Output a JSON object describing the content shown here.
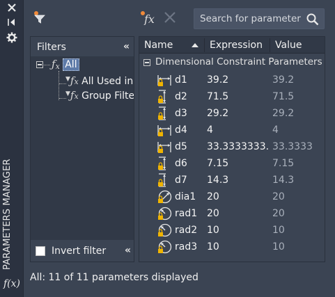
{
  "app": {
    "palette_title": "PARAMETERS MANAGER",
    "palette_fx": "f(x)"
  },
  "toolbar": {
    "search_placeholder": "Search for parameter"
  },
  "filters": {
    "title": "Filters",
    "tree": [
      {
        "label": "All",
        "selected": true
      },
      {
        "label": "All Used in"
      },
      {
        "label": "Group Filte"
      }
    ],
    "invert_label": "Invert filter",
    "invert_checked": false
  },
  "grid": {
    "columns": [
      "Name",
      "Expression",
      "Value"
    ],
    "group_label": "Dimensional Constraint Parameters",
    "rows": [
      {
        "name": "d1",
        "expression": "39.2",
        "value": "39.2",
        "icon": "horizontal-dim-lock-icon"
      },
      {
        "name": "d2",
        "expression": "71.5",
        "value": "71.5",
        "icon": "vertical-dim-lock-icon"
      },
      {
        "name": "d3",
        "expression": "29.2",
        "value": "29.2",
        "icon": "vertical-dim-lock-icon"
      },
      {
        "name": "d4",
        "expression": "4",
        "value": "4",
        "icon": "horizontal-dim-lock-icon"
      },
      {
        "name": "d5",
        "expression": "33.3333333...",
        "value": "33.3333",
        "icon": "horizontal-dim-lock-icon"
      },
      {
        "name": "d6",
        "expression": "7.15",
        "value": "7.15",
        "icon": "vertical-dim-lock-icon"
      },
      {
        "name": "d7",
        "expression": "14.3",
        "value": "14.3",
        "icon": "vertical-dim-lock-icon"
      },
      {
        "name": "dia1",
        "expression": "20",
        "value": "20",
        "icon": "diameter-dim-lock-icon"
      },
      {
        "name": "rad1",
        "expression": "20",
        "value": "20",
        "icon": "radius-dim-lock-icon"
      },
      {
        "name": "rad2",
        "expression": "10",
        "value": "10",
        "icon": "radius-dim-lock-icon"
      },
      {
        "name": "rad3",
        "expression": "10",
        "value": "10",
        "icon": "radius-dim-lock-icon"
      }
    ]
  },
  "status": {
    "text": "All: 11 of 11 parameters displayed"
  }
}
